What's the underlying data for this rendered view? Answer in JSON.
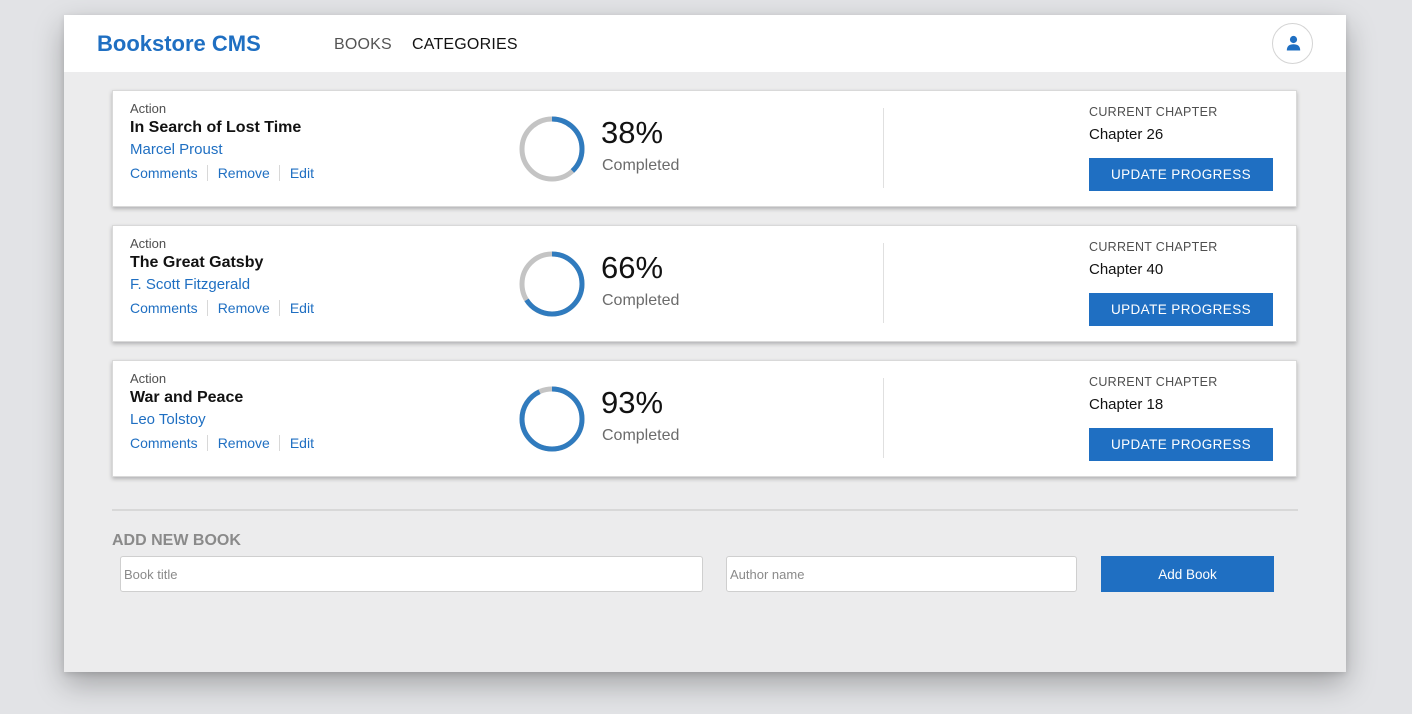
{
  "app": {
    "brand": "Bookstore CMS"
  },
  "nav": {
    "books": "BOOKS",
    "categories": "CATEGORIES"
  },
  "colors": {
    "accent": "#1f6fc2",
    "ring_track": "#c4c4c4",
    "ring_progress": "#307bbe"
  },
  "books": [
    {
      "genre": "Action",
      "title": "In Search of Lost Time",
      "author": "Marcel Proust",
      "actions": {
        "comments": "Comments",
        "remove": "Remove",
        "edit": "Edit"
      },
      "percent": "38%",
      "progress": 0.38,
      "completed_label": "Completed",
      "current_chapter_label": "CURRENT CHAPTER",
      "chapter": "Chapter 26",
      "update_label": "UPDATE PROGRESS"
    },
    {
      "genre": "Action",
      "title": "The Great Gatsby",
      "author": "F. Scott Fitzgerald",
      "actions": {
        "comments": "Comments",
        "remove": "Remove",
        "edit": "Edit"
      },
      "percent": "66%",
      "progress": 0.66,
      "completed_label": "Completed",
      "current_chapter_label": "CURRENT CHAPTER",
      "chapter": "Chapter 40",
      "update_label": "UPDATE PROGRESS"
    },
    {
      "genre": "Action",
      "title": "War and Peace",
      "author": "Leo Tolstoy",
      "actions": {
        "comments": "Comments",
        "remove": "Remove",
        "edit": "Edit"
      },
      "percent": "93%",
      "progress": 0.93,
      "completed_label": "Completed",
      "current_chapter_label": "CURRENT CHAPTER",
      "chapter": "Chapter 18",
      "update_label": "UPDATE PROGRESS"
    }
  ],
  "add_form": {
    "heading": "ADD NEW BOOK",
    "title_placeholder": "Book title",
    "title_value": "",
    "author_placeholder": "Author name",
    "author_value": "",
    "submit_label": "Add Book"
  },
  "icons": {
    "avatar": "user-icon"
  }
}
